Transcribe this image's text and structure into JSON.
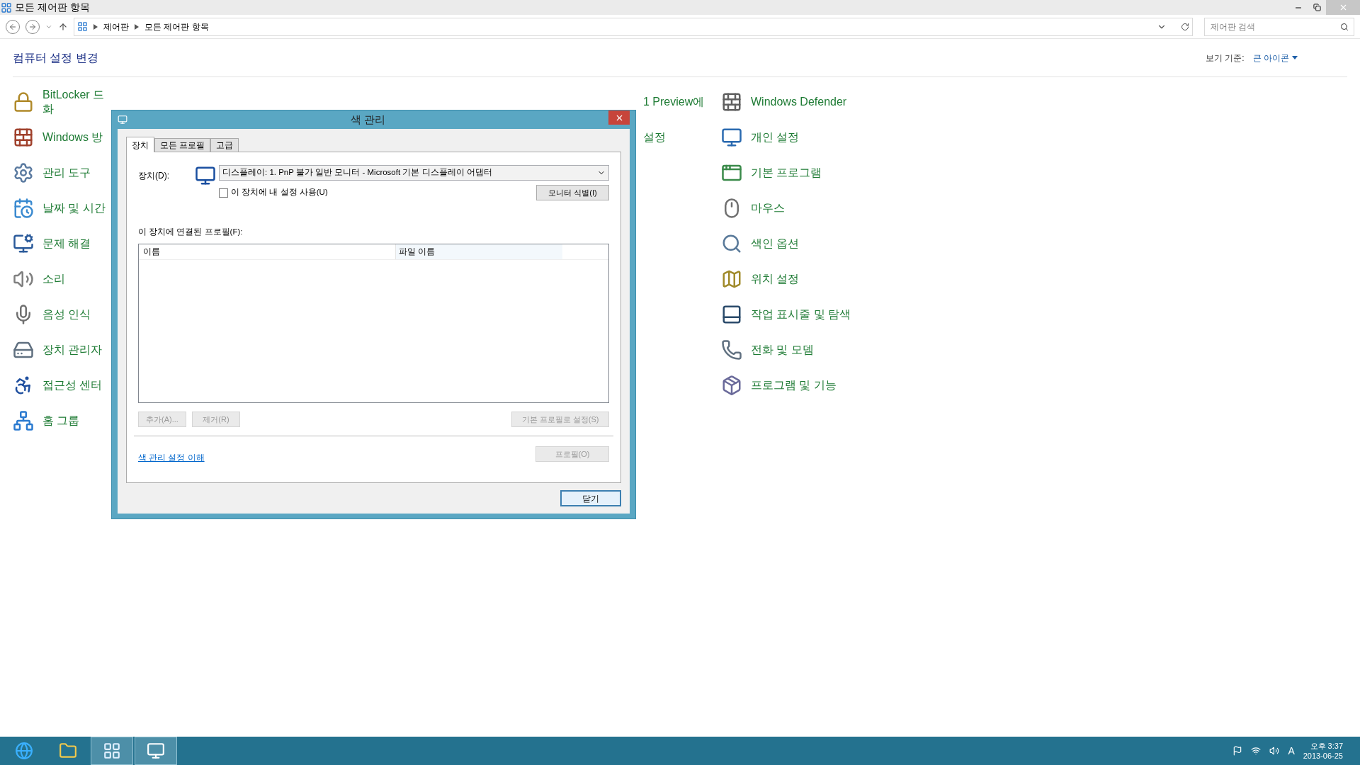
{
  "window": {
    "title": "모든 제어판 항목"
  },
  "address_bar": {
    "path": [
      "제어판",
      "모든 제어판 항목"
    ]
  },
  "search": {
    "placeholder": "제어판 검색"
  },
  "heading": "컴퓨터 설정 변경",
  "view_by": {
    "label": "보기 기준:",
    "value": "큰 아이콘"
  },
  "column_1": [
    {
      "kind": "lock",
      "lines": [
        "BitLocker 드",
        "화"
      ]
    },
    {
      "kind": "firewall",
      "lines": [
        "Windows 방"
      ]
    },
    {
      "kind": "tools",
      "lines": [
        "관리 도구"
      ]
    },
    {
      "kind": "calendar",
      "lines": [
        "날짜 및 시간"
      ]
    },
    {
      "kind": "troubleshoot",
      "lines": [
        "문제 해결"
      ]
    },
    {
      "kind": "speaker",
      "lines": [
        "소리"
      ]
    },
    {
      "kind": "mic",
      "lines": [
        "음성 인식"
      ]
    },
    {
      "kind": "device",
      "lines": [
        "장치 관리자"
      ]
    },
    {
      "kind": "accessibility",
      "lines": [
        "접근성 센터"
      ]
    },
    {
      "kind": "homegroup",
      "lines": [
        "홈 그룹"
      ]
    }
  ],
  "column_4": [
    {
      "lines": [
        "1 Preview에"
      ]
    },
    {
      "lines": [
        "설정"
      ]
    }
  ],
  "column_5": [
    {
      "kind": "wall",
      "lines": [
        "Windows Defender"
      ]
    },
    {
      "kind": "monitor",
      "lines": [
        "개인 설정"
      ]
    },
    {
      "kind": "default",
      "lines": [
        "기본 프로그램"
      ]
    },
    {
      "kind": "mouse",
      "lines": [
        "마우스"
      ]
    },
    {
      "kind": "search",
      "lines": [
        "색인 옵션"
      ]
    },
    {
      "kind": "map",
      "lines": [
        "위치 설정"
      ]
    },
    {
      "kind": "taskbar",
      "lines": [
        "작업 표시줄 및 탐색"
      ]
    },
    {
      "kind": "phone",
      "lines": [
        "전화 및 모뎀"
      ]
    },
    {
      "kind": "package",
      "lines": [
        "프로그램 및 기능"
      ]
    }
  ],
  "dialog": {
    "title": "색 관리",
    "tabs": [
      {
        "label": "장치",
        "selected": true
      },
      {
        "label": "모든 프로필",
        "selected": false
      },
      {
        "label": "고급",
        "selected": false
      }
    ],
    "device_label": "장치(D):",
    "device": "디스플레이: 1. PnP 불가 일반 모니터 - Microsoft 기본 디스플레이 어댑터",
    "use_my_settings": {
      "label": "이 장치에 내 설정 사용(U)",
      "checked": false
    },
    "identify_button": "모니터 식별(I)",
    "profiles_label": "이 장치에 연결된 프로필(F):",
    "columns": [
      "이름",
      "파일 이름"
    ],
    "row_buttons": [
      {
        "label": "추가(A)...",
        "disabled": true
      },
      {
        "label": "제거(R)",
        "disabled": true
      },
      {
        "label": "기본 프로필로 설정(S)",
        "disabled": true
      }
    ],
    "link": "색 관리 설정 이해",
    "profiles_button": {
      "label": "프로필(O)",
      "disabled": true
    },
    "close_button": "닫기"
  },
  "taskbar": {
    "apps": [
      {
        "kind": "browser",
        "active": false
      },
      {
        "kind": "folder",
        "active": false
      },
      {
        "kind": "control-panel",
        "active": true
      },
      {
        "kind": "color",
        "active": true
      }
    ],
    "ime": "A",
    "time": "오후 3:37",
    "date": "2013-06-25"
  }
}
